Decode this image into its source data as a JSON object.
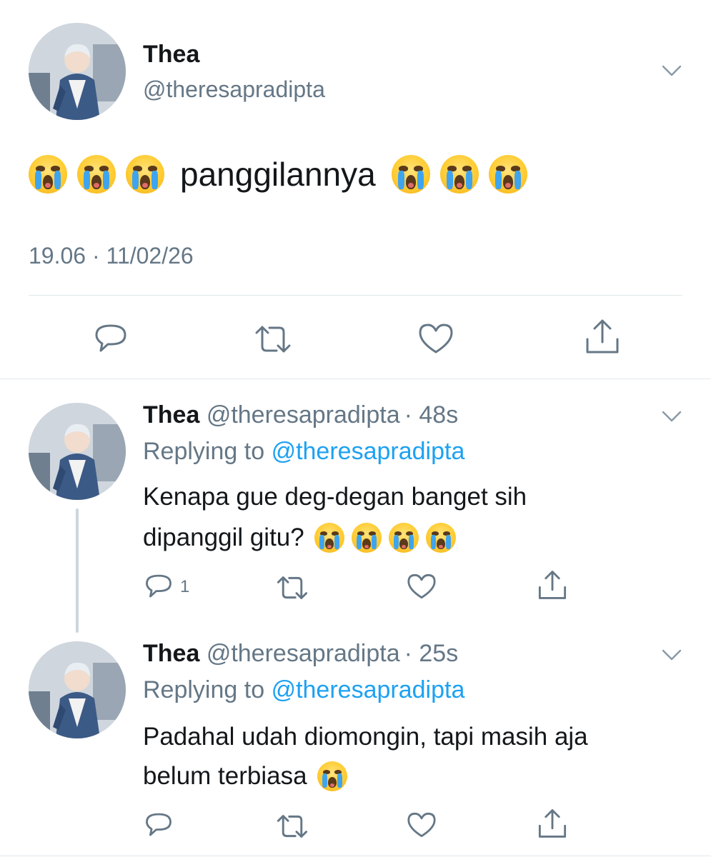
{
  "main_tweet": {
    "display_name": "Thea",
    "handle": "@theresapradipta",
    "text_before_emoji_count": 3,
    "text": "panggilannya",
    "text_after_emoji_count": 3,
    "timestamp": "19.06 · 11/02/26"
  },
  "replies": [
    {
      "display_name": "Thea",
      "handle": "@theresapradipta",
      "age": "· 48s",
      "replying_prefix": "Replying to",
      "replying_to": "@theresapradipta",
      "line1": "Kenapa gue deg-degan banget sih",
      "line2": "dipanggil gitu?",
      "line2_emoji_count": 4,
      "reply_count": "1"
    },
    {
      "display_name": "Thea",
      "handle": "@theresapradipta",
      "age": "· 25s",
      "replying_prefix": "Replying to",
      "replying_to": "@theresapradipta",
      "line1": "Padahal udah diomongin, tapi masih aja",
      "line2": "belum terbiasa",
      "line2_emoji_count": 1,
      "reply_count": ""
    }
  ],
  "icons": {
    "reply": "reply-bubble-icon",
    "retweet": "retweet-icon",
    "like": "heart-icon",
    "share": "share-icon",
    "more": "chevron-down-icon",
    "emoji": "loudly-crying-face-emoji"
  },
  "colors": {
    "text": "#14171a",
    "muted": "#657786",
    "link": "#1da1f2",
    "divider": "#e1e8ed",
    "icon": "#657786"
  }
}
